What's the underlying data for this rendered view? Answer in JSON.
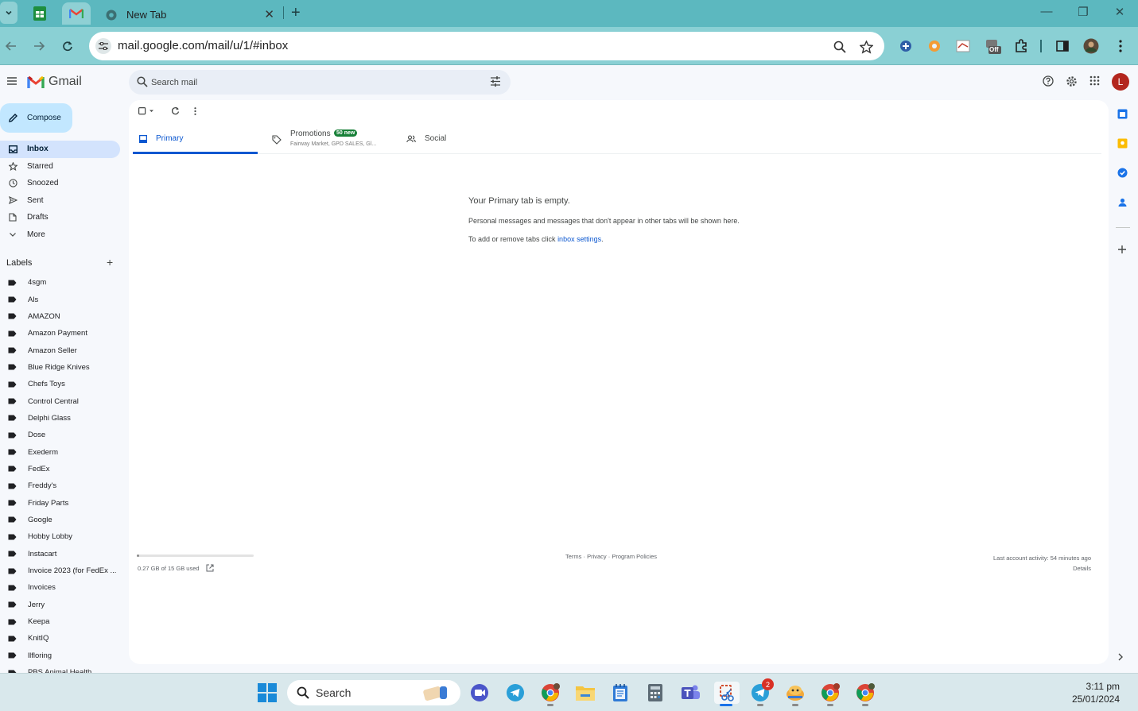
{
  "browser": {
    "tab_title": "New Tab",
    "url": "mail.google.com/mail/u/1/#inbox",
    "ext_badge": "Off"
  },
  "gmail": {
    "brand": "Gmail",
    "search_placeholder": "Search mail",
    "avatar_letter": "L",
    "compose_label": "Compose",
    "nav": [
      {
        "label": "Inbox",
        "icon": "inbox-icon"
      },
      {
        "label": "Starred",
        "icon": "star-icon"
      },
      {
        "label": "Snoozed",
        "icon": "clock-icon"
      },
      {
        "label": "Sent",
        "icon": "send-icon"
      },
      {
        "label": "Drafts",
        "icon": "draft-icon"
      },
      {
        "label": "More",
        "icon": "chevron-down-icon"
      }
    ],
    "labels_heading": "Labels",
    "labels": [
      "4sgm",
      "Als",
      "AMAZON",
      "Amazon Payment",
      "Amazon Seller",
      "Blue Ridge Knives",
      "Chefs Toys",
      "Control Central",
      "Delphi Glass",
      "Dose",
      "Exederm",
      "FedEx",
      "Freddy's",
      "Friday Parts",
      "Google",
      "Hobby Lobby",
      "Instacart",
      "Invoice 2023 (for FedEx ...",
      "Invoices",
      "Jerry",
      "Keepa",
      "KnitIQ",
      "llfloring",
      "PBS Animal Health"
    ],
    "tabs": {
      "primary": "Primary",
      "promotions": "Promotions",
      "promotions_badge": "50 new",
      "promotions_senders": "Fairway Market, GPD SALES, Gl...",
      "social": "Social"
    },
    "empty": {
      "title": "Your Primary tab is empty.",
      "line1": "Personal messages and messages that don't appear in other tabs will be shown here.",
      "line2_prefix": "To add or remove tabs click ",
      "line2_link": "inbox settings",
      "line2_suffix": "."
    },
    "footer": {
      "storage": "0.27 GB of 15 GB used",
      "storage_fraction": 0.018,
      "links": "Terms · Privacy · Program Policies",
      "activity": "Last account activity: 54 minutes ago",
      "details": "Details"
    }
  },
  "taskbar": {
    "search_label": "Search",
    "telegram_badge": "2",
    "time": "3:11 pm",
    "date": "25/01/2024"
  }
}
